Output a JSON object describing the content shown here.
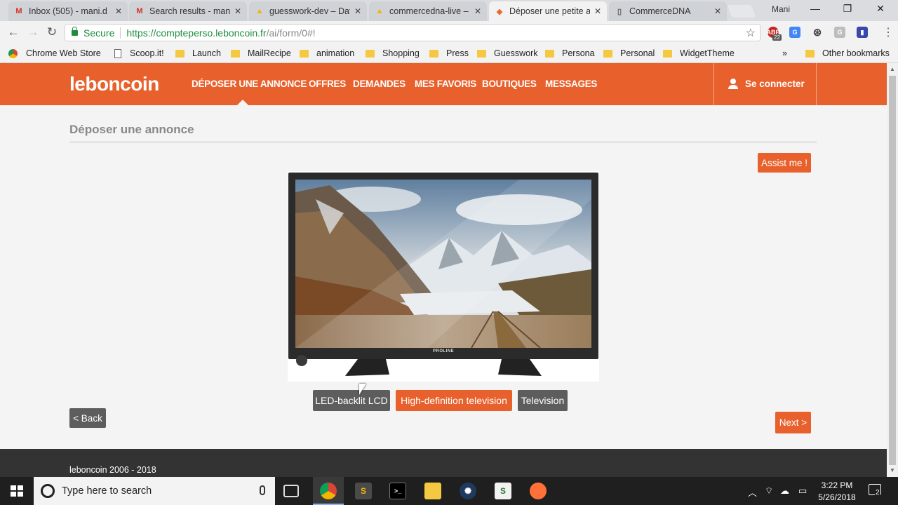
{
  "browser": {
    "tabs": [
      {
        "title": "Inbox (505) - mani.d",
        "icon": "gmail-icon",
        "active": false
      },
      {
        "title": "Search results - mani",
        "icon": "gmail-icon",
        "active": false
      },
      {
        "title": "guesswork-dev – Dat",
        "icon": "firebase-icon",
        "active": false
      },
      {
        "title": "commercedna-live –",
        "icon": "firebase-icon",
        "active": false
      },
      {
        "title": "Déposer une petite a",
        "icon": "leboncoin-icon",
        "active": true
      },
      {
        "title": "CommerceDNA",
        "icon": "page-icon",
        "active": false
      }
    ],
    "user_name": "Mani",
    "secure_label": "Secure",
    "url_host": "https://compteperso.leboncoin.fr",
    "url_path": "/ai/form/0#!",
    "extension_badge": "22",
    "bookmarks": [
      {
        "label": "Chrome Web Store",
        "type": "cws"
      },
      {
        "label": "Scoop.it!",
        "type": "page"
      },
      {
        "label": "Launch",
        "type": "folder"
      },
      {
        "label": "MailRecipe",
        "type": "folder"
      },
      {
        "label": "animation",
        "type": "folder"
      },
      {
        "label": "Shopping",
        "type": "folder"
      },
      {
        "label": "Press",
        "type": "folder"
      },
      {
        "label": "Guesswork",
        "type": "folder"
      },
      {
        "label": "Persona",
        "type": "folder"
      },
      {
        "label": "Personal",
        "type": "folder"
      },
      {
        "label": "WidgetTheme",
        "type": "folder"
      }
    ],
    "bookmarks_overflow": "»",
    "other_bookmarks": "Other bookmarks"
  },
  "site": {
    "logo": "leboncoin",
    "nav": [
      {
        "label": "DÉPOSER UNE ANNONCE",
        "active": true
      },
      {
        "label": "OFFRES",
        "active": false
      },
      {
        "label": "DEMANDES",
        "active": false
      },
      {
        "label": "MES FAVORIS",
        "active": false
      },
      {
        "label": "BOUTIQUES",
        "active": false
      },
      {
        "label": "MESSAGES",
        "active": false
      }
    ],
    "login_label": "Se connecter",
    "brand_color": "#e8612c"
  },
  "main": {
    "page_title": "Déposer une annonce",
    "assist_button": "Assist me !",
    "tags": [
      {
        "label": "LED-backlit LCD",
        "selected": false
      },
      {
        "label": "High-definition television",
        "selected": true
      },
      {
        "label": "Television",
        "selected": false
      }
    ],
    "back_button": "< Back",
    "next_button": "Next >",
    "product_brand": "PROLINE"
  },
  "footer": {
    "copyright": "leboncoin 2006 - 2018"
  },
  "taskbar": {
    "search_placeholder": "Type here to search",
    "time": "3:22 PM",
    "date": "5/26/2018",
    "notification_count": "2"
  }
}
